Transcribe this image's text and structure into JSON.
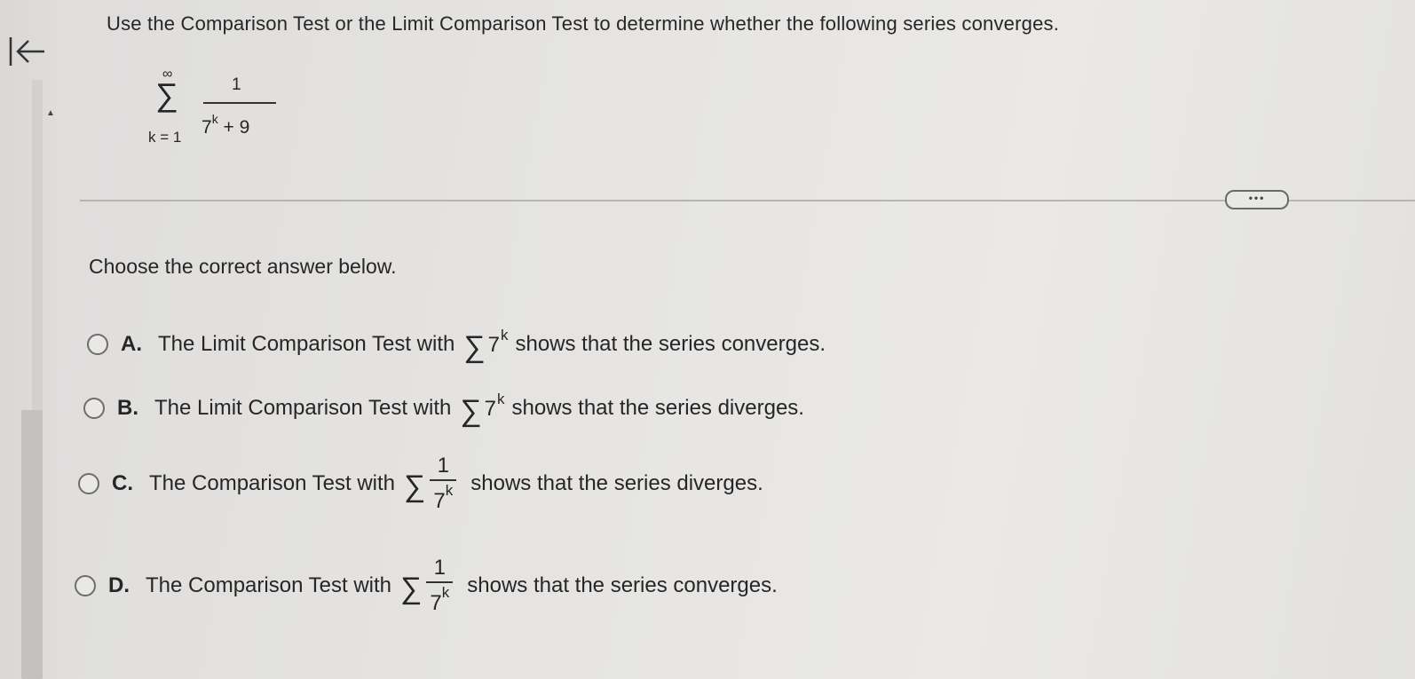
{
  "question": {
    "text": "Use the Comparison Test or the Limit Comparison Test to determine whether the following series converges."
  },
  "series": {
    "upper": "∞",
    "lower": "k = 1",
    "numerator": "1",
    "den_base": "7",
    "den_exp": "k",
    "den_rest": " + 9"
  },
  "more_button": {
    "label": "•••"
  },
  "prompt": "Choose the correct answer below.",
  "options": [
    {
      "letter": "A.",
      "before": "The Limit Comparison Test with",
      "base": "7",
      "exp": "k",
      "after": "shows that the series converges."
    },
    {
      "letter": "B.",
      "before": "The Limit Comparison Test with",
      "base": "7",
      "exp": "k",
      "after": "shows that the series diverges."
    },
    {
      "letter": "C.",
      "before": "The Comparison Test with",
      "num": "1",
      "base": "7",
      "exp": "k",
      "after": "shows that the series diverges."
    },
    {
      "letter": "D.",
      "before": "The Comparison Test with",
      "num": "1",
      "base": "7",
      "exp": "k",
      "after": "shows that the series converges."
    }
  ],
  "sigma_symbol": "∑",
  "scroll_arrow": "▲"
}
